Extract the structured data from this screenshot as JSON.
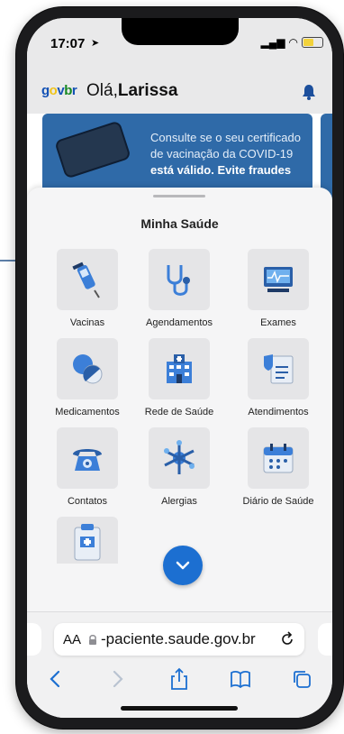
{
  "status_bar": {
    "time": "17:07"
  },
  "header": {
    "logo": {
      "g": "g",
      "o": "o",
      "v": "v",
      "b": "b",
      "r": "r"
    },
    "greeting_prefix": "Olá,",
    "user_name": "Larissa"
  },
  "banner": {
    "text": "Consulte se o seu certificado de vacinação da COVID-19",
    "bold_text": "está válido.",
    "cut_text": "Evite fraudes"
  },
  "sheet": {
    "title": "Minha Saúde",
    "tiles": [
      {
        "label": "Vacinas",
        "icon": "vaccine-icon"
      },
      {
        "label": "Agendamentos",
        "icon": "stethoscope-icon"
      },
      {
        "label": "Exames",
        "icon": "monitor-icon"
      },
      {
        "label": "Medicamentos",
        "icon": "pills-icon"
      },
      {
        "label": "Rede de Saúde",
        "icon": "hospital-icon"
      },
      {
        "label": "Atendimentos",
        "icon": "medical-record-icon"
      },
      {
        "label": "Contatos",
        "icon": "telephone-icon"
      },
      {
        "label": "Alergias",
        "icon": "allergy-icon"
      },
      {
        "label": "Diário de Saúde",
        "icon": "calendar-icon"
      },
      {
        "label": "",
        "icon": "clipboard-icon"
      }
    ]
  },
  "browser": {
    "aa_label": "AA",
    "url": "-paciente.saude.gov.br"
  },
  "colors": {
    "primary_blue": "#1c6fd1",
    "banner_blue": "#2f6aa8",
    "govbr_blue": "#1351b4",
    "govbr_yellow": "#f0c419",
    "govbr_green": "#168821"
  }
}
